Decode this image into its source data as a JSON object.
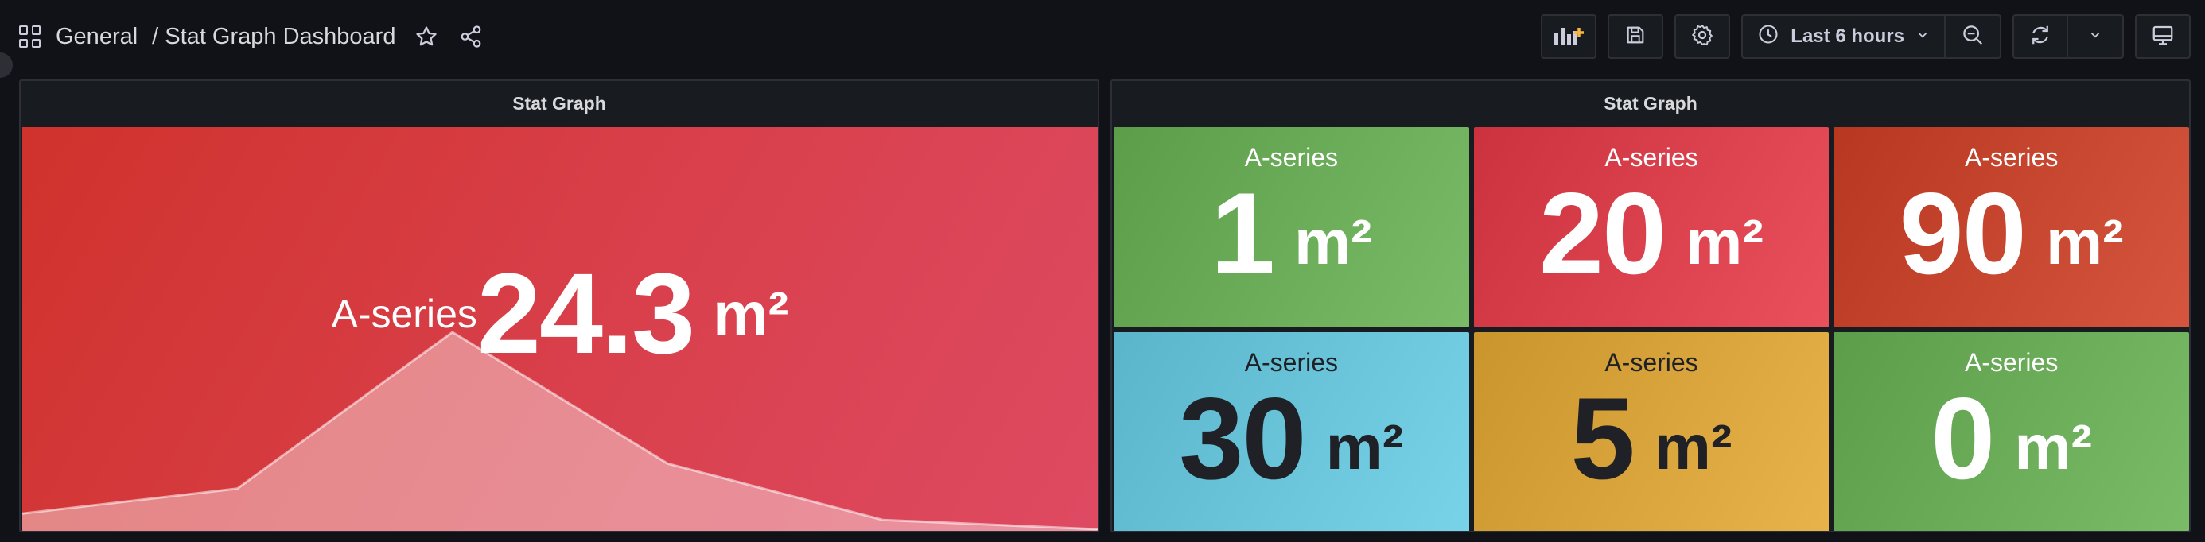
{
  "header": {
    "folder": "General",
    "title": "/ Stat Graph Dashboard",
    "time_range": "Last 6 hours"
  },
  "icons": {
    "apps": "grid-icon",
    "favorite": "star-icon",
    "share": "share-icon",
    "add_panel": "add-panel-icon",
    "save": "save-icon",
    "settings": "gear-icon",
    "clock": "clock-icon",
    "zoom_out": "zoom-out-icon",
    "refresh": "refresh-icon",
    "dropdown": "chevron-down-icon",
    "tv_mode": "monitor-icon"
  },
  "panels": [
    {
      "title": "Stat Graph",
      "series": "A-series",
      "value": "24.3",
      "unit": "m²",
      "color": "#d9404c",
      "sparkline": [
        5,
        13,
        63,
        21,
        3,
        0
      ]
    },
    {
      "title": "Stat Graph",
      "tiles": [
        {
          "series": "A-series",
          "value": "1",
          "unit": "m²",
          "color": "#6aab58",
          "text": "light"
        },
        {
          "series": "A-series",
          "value": "20",
          "unit": "m²",
          "color": "#d9404c",
          "text": "light"
        },
        {
          "series": "A-series",
          "value": "90",
          "unit": "m²",
          "color": "#c6452e",
          "text": "light"
        },
        {
          "series": "A-series",
          "value": "30",
          "unit": "m²",
          "color": "#68c3d9",
          "text": "dark"
        },
        {
          "series": "A-series",
          "value": "5",
          "unit": "m²",
          "color": "#d7a33a",
          "text": "dark"
        },
        {
          "series": "A-series",
          "value": "0",
          "unit": "m²",
          "color": "#6aab58",
          "text": "light"
        }
      ]
    }
  ]
}
